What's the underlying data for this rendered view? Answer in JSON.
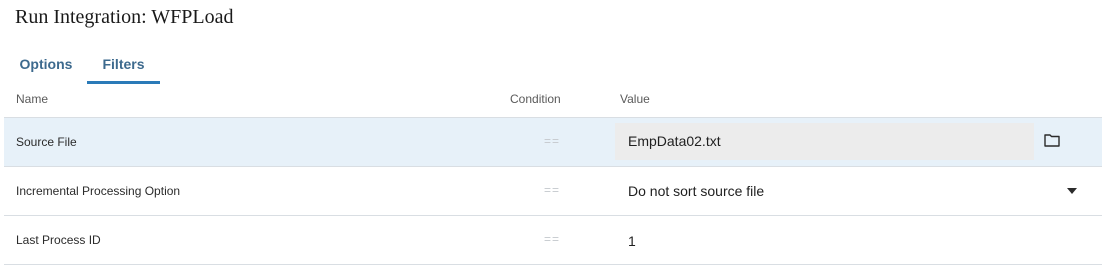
{
  "header": {
    "title": "Run Integration: WFPLoad"
  },
  "tabs": [
    {
      "label": "Options",
      "active": false
    },
    {
      "label": "Filters",
      "active": true
    }
  ],
  "table": {
    "columns": {
      "name": "Name",
      "condition": "Condition",
      "value": "Value"
    },
    "rows": [
      {
        "name": "Source File",
        "condition": "==",
        "value": "EmpData02.txt",
        "icon": "folder-icon",
        "selected": true
      },
      {
        "name": "Incremental Processing Option",
        "condition": "==",
        "value": "Do not sort source file",
        "icon": "chevron-down-icon",
        "selected": false
      },
      {
        "name": "Last Process ID",
        "condition": "==",
        "value": "1",
        "selected": false
      }
    ]
  },
  "colors": {
    "accent": "#2a7ab8",
    "tab_text": "#3d6a8e",
    "selected_row": "#e7f1f9",
    "field_bg": "#ececec"
  }
}
